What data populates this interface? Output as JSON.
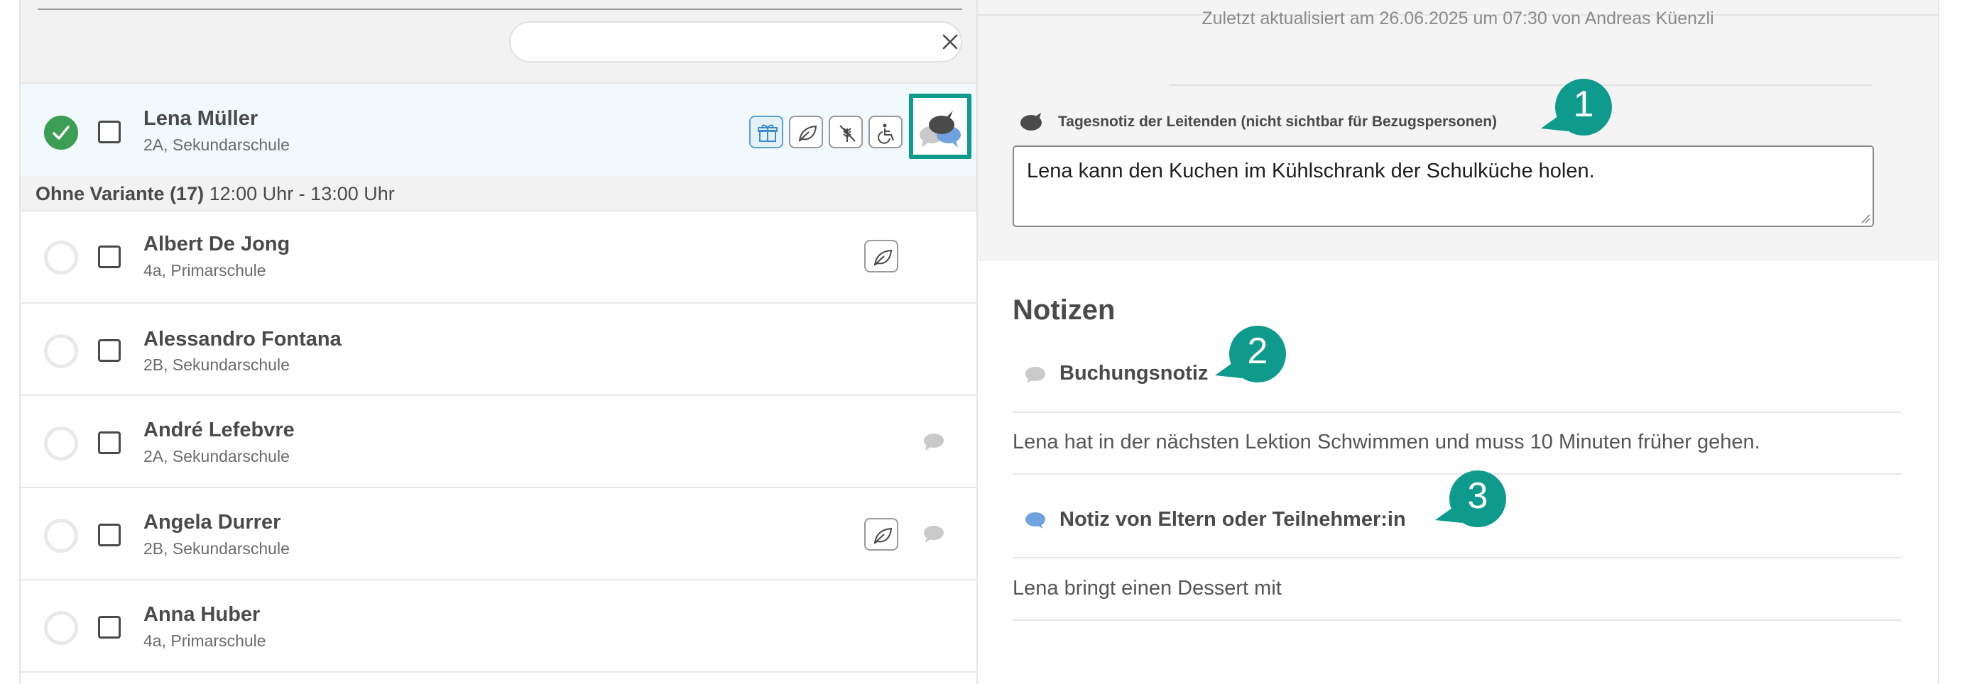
{
  "search": {
    "value": "",
    "placeholder": "",
    "clear_icon": "close-icon"
  },
  "selected_person": {
    "name": "Lena Müller",
    "class": "2A, Sekundarschule",
    "status": "checked-in",
    "badges": [
      "gift-icon",
      "leaf-icon",
      "no-gluten-icon",
      "wheelchair-icon"
    ],
    "notes_icon": "speech-bubbles-icon"
  },
  "group": {
    "name": "Ohne Variante (17)",
    "time": "12:00 Uhr - 13:00 Uhr"
  },
  "people": [
    {
      "name": "Albert De Jong",
      "class": "4a, Primarschule",
      "badges": [
        "leaf-icon"
      ],
      "has_note": false
    },
    {
      "name": "Alessandro Fontana",
      "class": "2B, Sekundarschule",
      "badges": [],
      "has_note": false
    },
    {
      "name": "André Lefebvre",
      "class": "2A, Sekundarschule",
      "badges": [],
      "has_note": true
    },
    {
      "name": "Angela Durrer",
      "class": "2B, Sekundarschule",
      "badges": [
        "leaf-icon"
      ],
      "has_note": true
    },
    {
      "name": "Anna Huber",
      "class": "4a, Primarschule",
      "badges": [],
      "has_note": false
    }
  ],
  "detail": {
    "updated": "Zuletzt aktualisiert am 26.06.2025 um 07:30 von Andreas Küenzli",
    "daily_note_label": "Tagesnotiz der Leitenden (nicht sichtbar für Bezugspersonen)",
    "daily_note_value": "Lena kann den Kuchen im Kühlschrank der Schulküche holen.",
    "notes_title": "Notizen",
    "booking_note_title": "Buchungsnotiz",
    "booking_note_text": "Lena hat in der nächsten Lektion Schwimmen und muss 10 Minuten früher gehen.",
    "parent_note_title": "Notiz von Eltern oder Teilnehmer:in",
    "parent_note_text": "Lena bringt einen Dessert mit"
  },
  "callouts": [
    "1",
    "2",
    "3"
  ],
  "colors": {
    "accent": "#0e9b8d",
    "success": "#3c9e55",
    "parent_note": "#6fa3df",
    "booking_note": "#c9c9c9",
    "daily_note": "#4a4a4a"
  }
}
